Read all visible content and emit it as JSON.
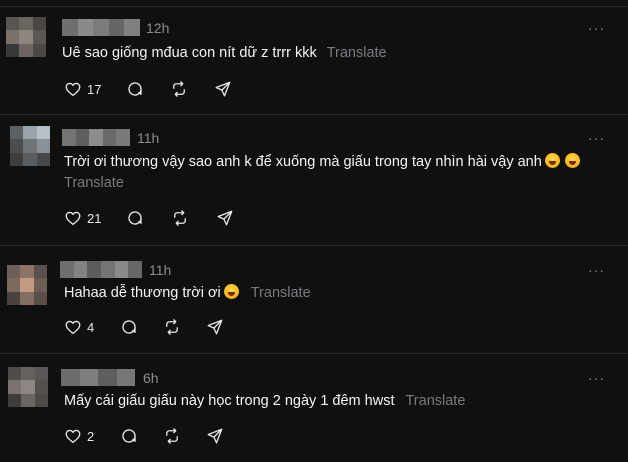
{
  "translate_label": "Translate",
  "more_label": "···",
  "comments": [
    {
      "time": "12h",
      "text": "Uê sao giống mđua con nít dữ z trrr kkk",
      "likes": "17",
      "avatar_colors": [
        "#5a5552",
        "#6b6560",
        "#4a4644",
        "#7a716c",
        "#8f857f",
        "#5c5753",
        "#3a3837",
        "#6d6662",
        "#4c4846"
      ],
      "name_colors": [
        "#6f6f6f",
        "#8a8a8a",
        "#7b7b7b",
        "#666666",
        "#7f7f7f"
      ]
    },
    {
      "time": "11h",
      "text": "Trời ơi thương vậy sao anh k để xuống mà giấu trong tay nhìn hài vậy anh",
      "likes": "21",
      "avatar_colors": [
        "#5e6164",
        "#9aa3a8",
        "#b7c0c4",
        "#4b4d4f",
        "#6f7478",
        "#8b9297",
        "#3d3e40",
        "#5a5d60",
        "#47494b"
      ],
      "name_colors": [
        "#747474",
        "#5f5f5f",
        "#8c8c8c",
        "#6a6a6a",
        "#7a7a7a"
      ]
    },
    {
      "time": "11h",
      "text": "Hahaa dễ thương trời ơi",
      "likes": "4",
      "avatar_colors": [
        "#6b5f58",
        "#8c7466",
        "#5a4f4a",
        "#7d6a5f",
        "#c09a82",
        "#6e5d54",
        "#4a423e",
        "#826e63",
        "#5b4e47"
      ],
      "name_colors": [
        "#6e6e6e",
        "#828282",
        "#5c5c5c",
        "#747474",
        "#8a8a8a",
        "#676767"
      ]
    },
    {
      "time": "6h",
      "text": "Mấy cái giấu giấu này học trong 2 ngày 1 đêm hwst",
      "likes": "2",
      "avatar_colors": [
        "#4f4c4b",
        "#66615f",
        "#5a5655",
        "#7a7371",
        "#8e8683",
        "#54504e",
        "#3f3d3c",
        "#6a6462",
        "#4c4948"
      ],
      "name_colors": [
        "#6c6c6c",
        "#7e7e7e",
        "#5e5e5e",
        "#777777"
      ]
    }
  ]
}
